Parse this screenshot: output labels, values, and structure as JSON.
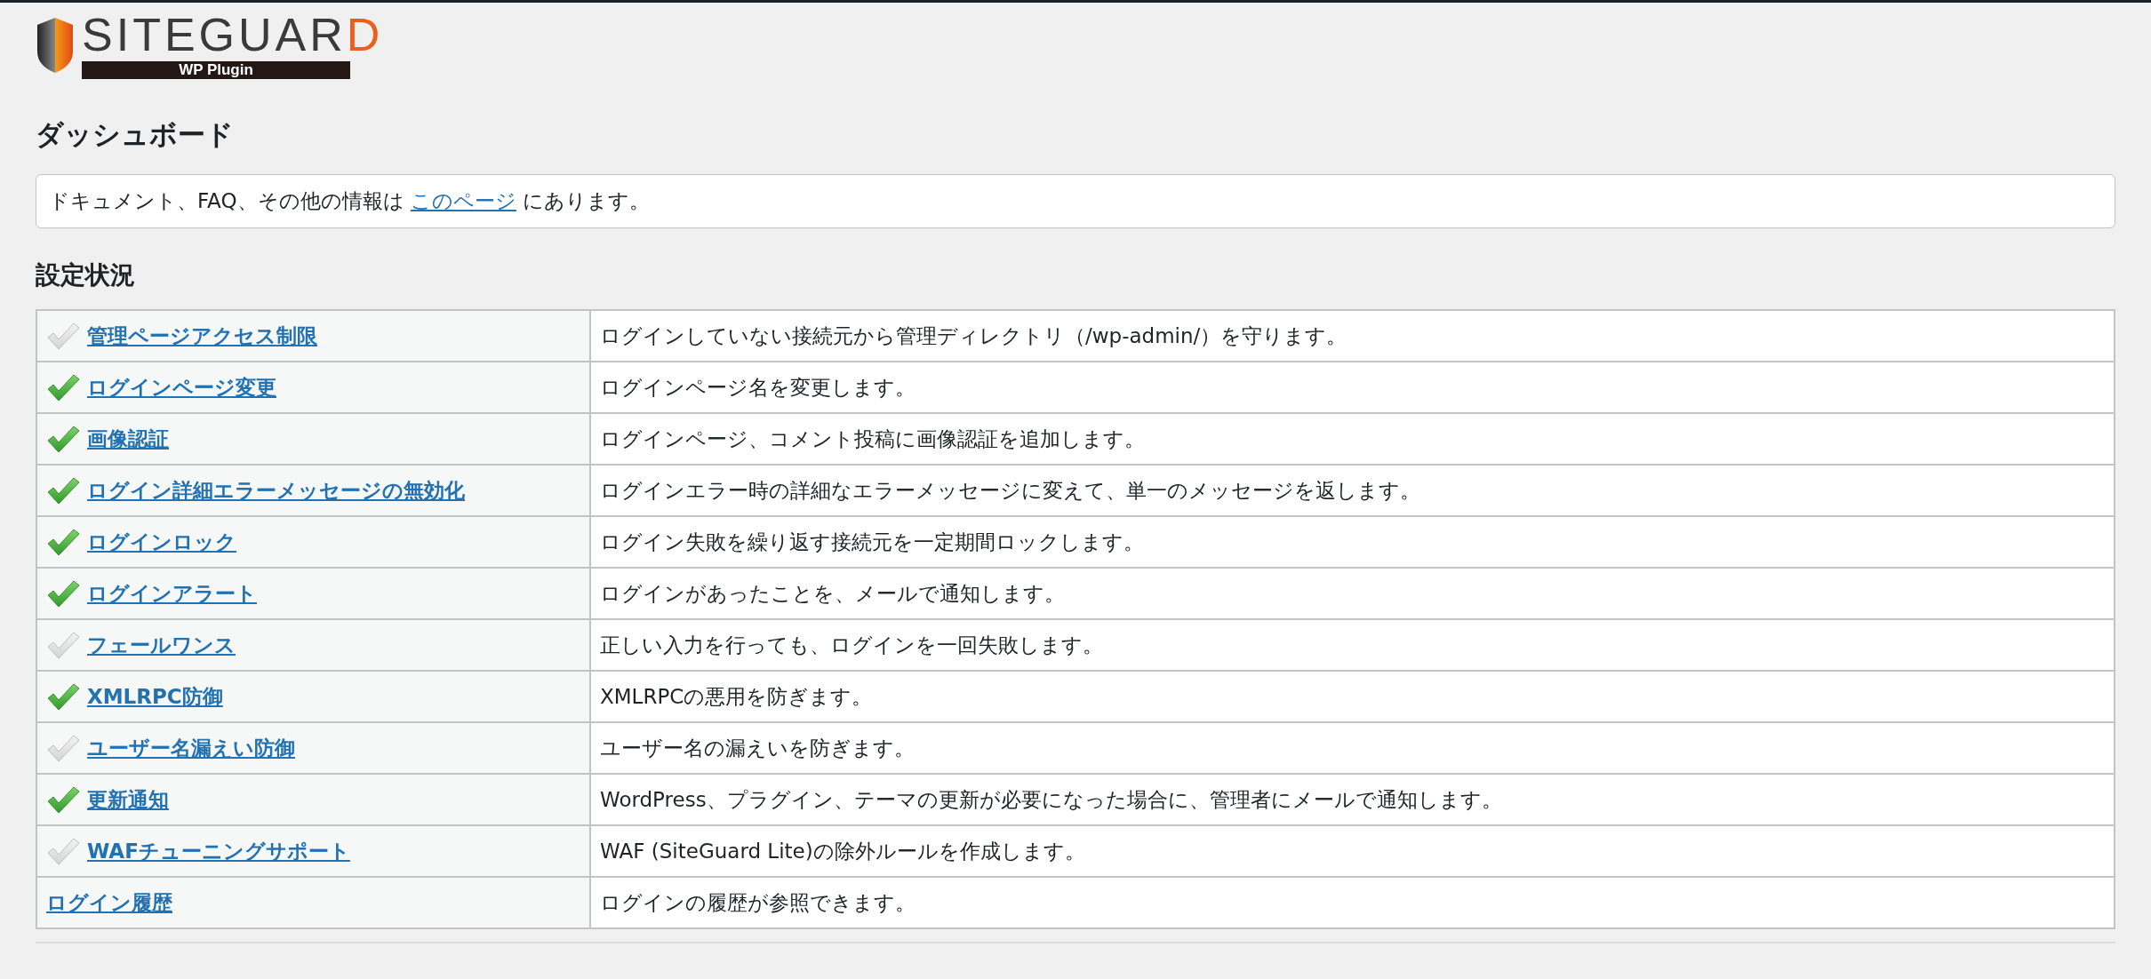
{
  "logo": {
    "name": "SITEGUARD",
    "subtitle": "WP Plugin"
  },
  "title": "ダッシュボード",
  "notice": {
    "before": "ドキュメント、FAQ、その他の情報は",
    "link": "このページ",
    "after": "にあります。"
  },
  "section_title": "設定状況",
  "rows": [
    {
      "kind": "status",
      "checked": false,
      "feature": "管理ページアクセス制限",
      "description": "ログインしていない接続元から管理ディレクトリ（/wp-admin/）を守ります。"
    },
    {
      "kind": "status",
      "checked": true,
      "feature": "ログインページ変更",
      "description": "ログインページ名を変更します。"
    },
    {
      "kind": "status",
      "checked": true,
      "feature": "画像認証",
      "description": "ログインページ、コメント投稿に画像認証を追加します。"
    },
    {
      "kind": "status",
      "checked": true,
      "feature": "ログイン詳細エラーメッセージの無効化",
      "description": "ログインエラー時の詳細なエラーメッセージに変えて、単一のメッセージを返します。"
    },
    {
      "kind": "status",
      "checked": true,
      "feature": "ログインロック",
      "description": "ログイン失敗を繰り返す接続元を一定期間ロックします。"
    },
    {
      "kind": "status",
      "checked": true,
      "feature": "ログインアラート",
      "description": "ログインがあったことを、メールで通知します。"
    },
    {
      "kind": "status",
      "checked": false,
      "feature": "フェールワンス",
      "description": "正しい入力を行っても、ログインを一回失敗します。"
    },
    {
      "kind": "status",
      "checked": true,
      "feature": "XMLRPC防御",
      "description": "XMLRPCの悪用を防ぎます。"
    },
    {
      "kind": "status",
      "checked": false,
      "feature": "ユーザー名漏えい防御",
      "description": "ユーザー名の漏えいを防ぎます。"
    },
    {
      "kind": "status",
      "checked": true,
      "feature": "更新通知",
      "description": "WordPress、プラグイン、テーマの更新が必要になった場合に、管理者にメールで通知します。"
    },
    {
      "kind": "status",
      "checked": false,
      "feature": "WAFチューニングサポート",
      "description": "WAF (SiteGuard Lite)の除外ルールを作成します。"
    },
    {
      "kind": "plain",
      "feature": "ログイン履歴",
      "description": "ログインの履歴が参照できます。"
    }
  ]
}
